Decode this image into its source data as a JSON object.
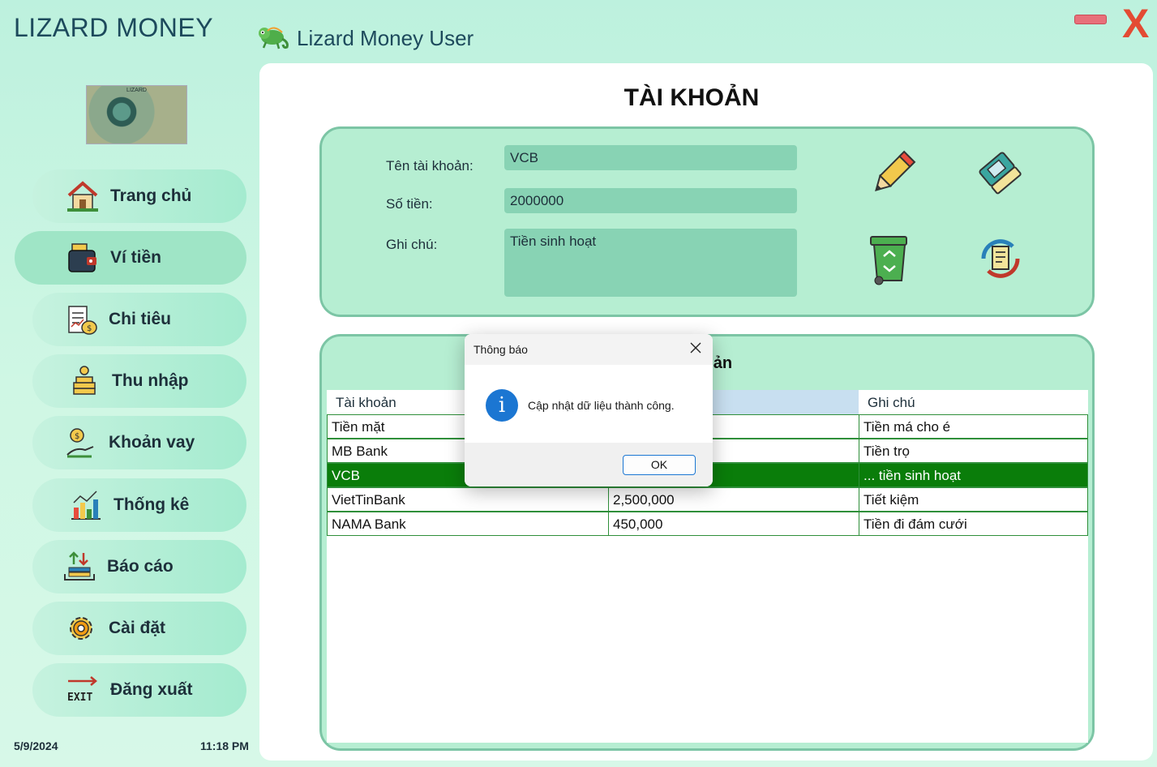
{
  "window": {
    "app_title": "LIZARD MONEY",
    "user_name": "Lizard Money User",
    "minimize_icon": "minimize-icon",
    "close_label": "X"
  },
  "logo": {
    "text": "LIZARD"
  },
  "nav": {
    "items": [
      {
        "label": "Trang chủ",
        "icon": "home-icon"
      },
      {
        "label": "Ví tiền",
        "icon": "wallet-icon",
        "active": true
      },
      {
        "label": "Chi tiêu",
        "icon": "expense-icon"
      },
      {
        "label": "Thu nhập",
        "icon": "income-icon"
      },
      {
        "label": "Khoản vay",
        "icon": "loan-icon"
      },
      {
        "label": "Thống kê",
        "icon": "statistics-icon"
      },
      {
        "label": "Báo cáo",
        "icon": "report-icon"
      },
      {
        "label": "Cài đặt",
        "icon": "settings-icon"
      },
      {
        "label": "Đăng xuất",
        "icon": "exit-icon"
      }
    ]
  },
  "status": {
    "date": "5/9/2024",
    "time": "11:18 PM"
  },
  "page": {
    "title": "TÀI KHOẢN"
  },
  "form": {
    "account_name_label": "Tên tài khoản:",
    "account_name_value": "VCB",
    "amount_label": "Số tiền:",
    "amount_value": "2000000",
    "note_label": "Ghi chú:",
    "note_value": "Tiền sinh hoạt",
    "actions": [
      "pencil-icon",
      "eraser-icon",
      "trash-icon",
      "refresh-document-icon"
    ]
  },
  "table": {
    "title_visible": "Khoản",
    "headers": [
      "Tài khoản",
      "",
      "Ghi chú"
    ],
    "rows": [
      {
        "account": "Tiền mặt",
        "amount": "",
        "note": "Tiền má cho é"
      },
      {
        "account": "MB Bank",
        "amount": "",
        "note": "Tiền trọ"
      },
      {
        "account": "VCB",
        "amount": "",
        "note": "... tiền sinh hoạt"
      },
      {
        "account": "VietTinBank",
        "amount": "2,500,000",
        "note": "Tiết kiệm"
      },
      {
        "account": "NAMA Bank",
        "amount": "450,000",
        "note": "Tiền đi đám cưới"
      }
    ],
    "selected_row": 2
  },
  "dialog": {
    "title": "Thông báo",
    "message": "Cập nhật dữ liệu thành công.",
    "ok_label": "OK",
    "info_glyph": "i"
  },
  "colors": {
    "accent_green": "#0a7d0a",
    "card_bg": "#b6eed2",
    "field_bg": "#88d3b4",
    "close_red": "#e34b33"
  }
}
